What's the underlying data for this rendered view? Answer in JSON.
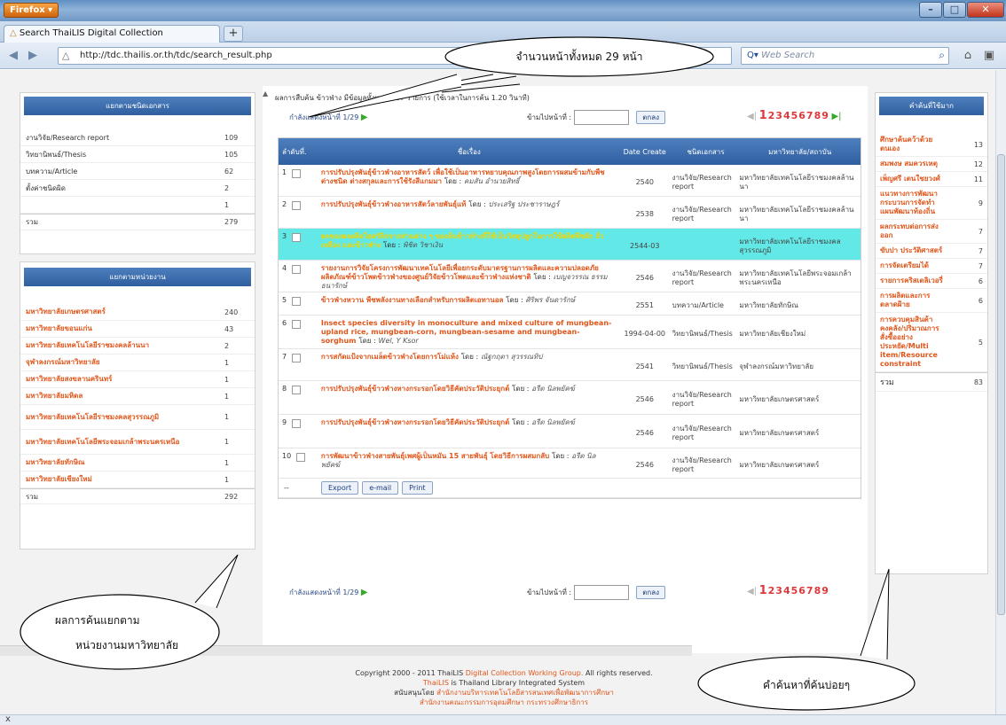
{
  "browser": {
    "app_button": "Firefox",
    "tab_title": "Search ThaiLIS Digital Collection",
    "url": "http://tdc.thailis.or.th/tdc/search_result.php",
    "search_placeholder": "Web Search",
    "status_text": "x"
  },
  "left": {
    "doc_type_header": "แยกตามชนิดเอกสาร",
    "doc_types": [
      {
        "label": "งานวิจัย/Research report",
        "count": "109"
      },
      {
        "label": "วิทยานิพนธ์/Thesis",
        "count": "105"
      },
      {
        "label": "บทความ/Article",
        "count": "62"
      },
      {
        "label": "ตั้งค่าชนิดผิด",
        "count": "2"
      },
      {
        "label": "",
        "count": "1"
      },
      {
        "label": "รวม",
        "count": "279"
      }
    ],
    "agency_header": "แยกตามหน่วยงาน",
    "agencies": [
      {
        "label": "มหาวิทยาลัยเกษตรศาสตร์",
        "count": "240"
      },
      {
        "label": "มหาวิทยาลัยขอนแก่น",
        "count": "43"
      },
      {
        "label": "มหาวิทยาลัยเทคโนโลยีราชมงคลล้านนา",
        "count": "2"
      },
      {
        "label": "จุฬาลงกรณ์มหาวิทยาลัย",
        "count": "1"
      },
      {
        "label": "มหาวิทยาลัยสงขลานครินทร์",
        "count": "1"
      },
      {
        "label": "มหาวิทยาลัยมหิดล",
        "count": "1"
      },
      {
        "label": "มหาวิทยาลัยเทคโนโลยีราชมงคลสุวรรณภูมิ",
        "count": "1"
      },
      {
        "label": "มหาวิทยาลัยเทคโนโลยีพระจอมเกล้าพระนครเหนือ",
        "count": "1"
      },
      {
        "label": "มหาวิทยาลัยทักษิณ",
        "count": "1"
      },
      {
        "label": "มหาวิทยาลัยเชียงใหม่",
        "count": "1"
      }
    ],
    "agency_total_label": "รวม",
    "agency_total": "292"
  },
  "main": {
    "summary": "ผลการสืบค้น ข้าวฟ่าง มีข้อมูลทั้งหมด 287 รายการ (ใช้เวลาในการค้น 1.20 วินาที)",
    "showing_page": "กำลังแสดงหน้าที่ 1/29",
    "jump_label": "ข้ามไปหน้าที่ :",
    "go_button": "ตกลง",
    "page_current": "1",
    "page_others": "23456789",
    "columns": {
      "no": "ลำดับที่.",
      "title": "ชื่อเรื่อง",
      "date": "Date Create",
      "type": "ชนิดเอกสาร",
      "inst": "มหาวิทยาลัย/สถาบัน"
    },
    "by_label": "โดย :",
    "rows": [
      {
        "no": "1",
        "title": "การปรับปรุงพันธุ์ข้าวฟ่างอาหารสัตว์ เพื่อใช้เป็นอาหารหยาบคุณภาพสูงโดยการผสมข้ามกับพืชต่างชนิด ต่างสกุลและการใช้รังสีแกมมา",
        "author": "คมสัน อำนวยสิทธิ์",
        "date": "2540",
        "type": "งานวิจัย/Research report",
        "inst": "มหาวิทยาลัยเทคโนโลยีราชมงคลล้านนา"
      },
      {
        "no": "2",
        "title": "การปรับปรุงพันธุ์ข้าวฟ่างอาหารสัตว์ลายพันธุ์แท้",
        "author": "ประเสริฐ ประชาราษฎร์",
        "date": "2538",
        "type": "งานวิจัย/Research report",
        "inst": "มหาวิทยาลัยเทคโนโลยีราชมงคลล้านนา"
      },
      {
        "no": "3",
        "title": "ผลของผลผลิตไฮดรัลิกจากส่วนต่าง ๆ ของต้นข้าวฟ่างที่ใช้เป็นวัสดุปลูกในการใช้ผลิตพืชผัก ถั่วเหลือง และข้าวฟ่าง",
        "author": "พิชิต วิชาเงิน",
        "date": "2544-03",
        "type": "",
        "inst": "มหาวิทยาลัยเทคโนโลยีราชมงคลสุวรรณภูมิ"
      },
      {
        "no": "4",
        "title": "รายงานการวิจัยโครงการพัฒนาเทคโนโลยีเพื่อยกระดับมาตรฐานการผลิตและความปลอดภัยผลิตภัณฑ์ข้าวโพดข้าวฟ่างของศูนย์วิจัยข้าวโพดและข้าวฟ่างแห่งชาติ",
        "author": "เบญจวรรณ ธรรมธนารักษ์",
        "date": "2546",
        "type": "งานวิจัย/Research report",
        "inst": "มหาวิทยาลัยเทคโนโลยีพระจอมเกล้าพระนครเหนือ"
      },
      {
        "no": "5",
        "title": "ข้าวฟ่างหวาน พืชพลังงานทางเลือกสำหรับการผลิตเอทานอล",
        "author": "ศิริพร จันดารักษ์",
        "date": "2551",
        "type": "บทความ/Article",
        "inst": "มหาวิทยาลัยทักษิณ"
      },
      {
        "no": "6",
        "title": "Insect species diversity in monoculture and mixed culture of mungbean-upland rice, mungbean-corn, mungbean-sesame and mungbean-sorghum",
        "author": "Wel, Y Ksor",
        "date": "1994-04-00",
        "type": "วิทยานิพนธ์/Thesis",
        "inst": "มหาวิทยาลัยเชียงใหม่"
      },
      {
        "no": "7",
        "title": "การสกัดแป้งจากเมล็ดข้าวฟ่างโดยการโม่แห้ง",
        "author": "ณัฐกฤตา สุวรรณทิป",
        "date": "2541",
        "type": "วิทยานิพนธ์/Thesis",
        "inst": "จุฬาลงกรณ์มหาวิทยาลัย"
      },
      {
        "no": "8",
        "title": "การปรับปรุงพันธุ์ข้าวฟ่างหางกระรอกโดยวิธีคัดประวัติประยุกต์",
        "author": "อรีต นิลพยัคฆ์",
        "date": "2546",
        "type": "งานวิจัย/Research report",
        "inst": "มหาวิทยาลัยเกษตรศาสตร์"
      },
      {
        "no": "9",
        "title": "การปรับปรุงพันธุ์ข้าวฟ่างหางกระรอกโดยวิธีคัดประวัติประยุกต์",
        "author": "อรีต นิลพยัคฆ์",
        "date": "2546",
        "type": "งานวิจัย/Research report",
        "inst": "มหาวิทยาลัยเกษตรศาสตร์"
      },
      {
        "no": "10",
        "title": "การพัฒนาข้าวฟ่างสายพันธุ์เพศผู้เป็นหมัน 15 สายพันธุ์ โดยวิธีการผสมกลับ",
        "author": "อรีต นิลพยัคฆ์",
        "date": "2546",
        "type": "งานวิจัย/Research report",
        "inst": "มหาวิทยาลัยเกษตรศาสตร์"
      }
    ],
    "dash": "--",
    "actions": [
      "Export",
      "e-mail",
      "Print"
    ]
  },
  "right": {
    "header": "คำค้นที่ใช้มาก",
    "items": [
      {
        "label": "ศึกษาค้นคว้าด้วยตนเอง",
        "count": "13"
      },
      {
        "label": "สมพงษ สมควรเหตุ",
        "count": "12"
      },
      {
        "label": "เพ็ญศรี เตนใชยวงศ์",
        "count": "11"
      },
      {
        "label": "แนวทางการพัฒนากระบวนการจัดทำแผนพัฒนาท้องถิ่น",
        "count": "9"
      },
      {
        "label": "ผลกระทบต่อการส่งออก",
        "count": "7"
      },
      {
        "label": "ขับปา ประวัติศาสตร์",
        "count": "7"
      },
      {
        "label": "การจัดเตรียมได้",
        "count": "7"
      },
      {
        "label": "รายการคริสเตลิเวอรี่",
        "count": "6"
      },
      {
        "label": "การผลิตและการตลาดฝ้าย",
        "count": "6"
      },
      {
        "label": "การควบคุมสินค้าคงคลัง/ปริมาณการสั่งซื้ออย่างประหยัด/Multi item/Resource constraint",
        "count": "5"
      }
    ],
    "total_label": "รวม",
    "total": "83"
  },
  "footer": {
    "line1_a": "Copyright 2000 - 2011 ThaiLIS",
    "line1_b": "Digital Collection Working Group.",
    "line1_c": "All rights reserved.",
    "line2_a": "ThaiLIS",
    "line2_b": "is Thailand Library Integrated System",
    "line3_a": "สนับสนุนโดย",
    "line3_b": "สำนักงานบริหารเทคโนโลยีสารสนเทศเพื่อพัฒนาการศึกษา",
    "line4": "สำนักงานคณะกรรมการอุดมศึกษา กระทรวงศึกษาธิการ"
  },
  "callouts": {
    "pages": "จำนวนหน้าทั้งหมด 29 หน้า",
    "agency_line1": "ผลการค้นแยกตาม",
    "agency_line2": "หน่วยงานมหาวิทยาลัย",
    "popular": "คำค้นหาที่ค้นบ่อยๆ"
  }
}
